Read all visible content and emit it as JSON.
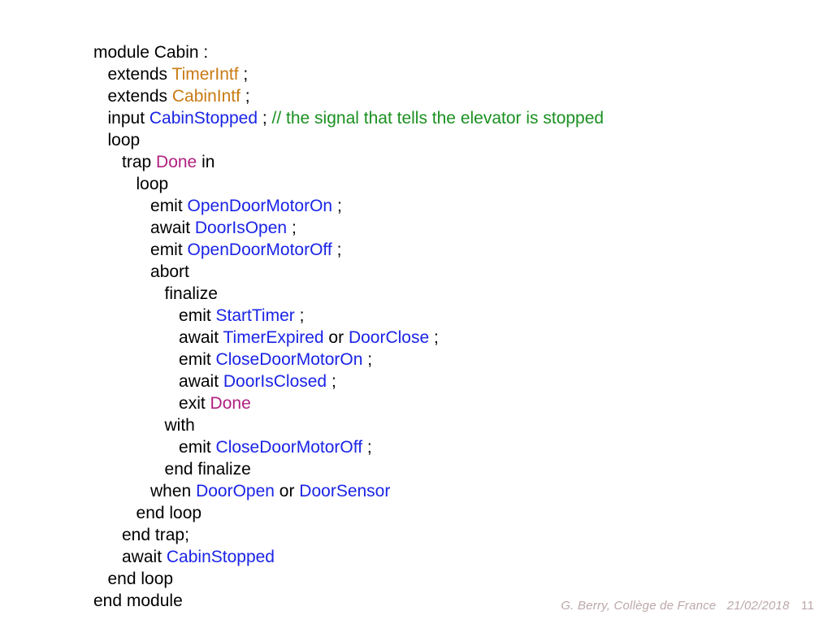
{
  "footer": {
    "author": "G. Berry, Collège de France",
    "date": "21/02/2018",
    "page": "11"
  },
  "code": {
    "l01a": "module Cabin :",
    "l02a": "   extends ",
    "l02b": "TimerIntf",
    "l02c": " ;",
    "l03a": "   extends ",
    "l03b": "CabinIntf",
    "l03c": " ;",
    "l04a": "   input ",
    "l04b": "CabinStopped",
    "l04c": " ; ",
    "l04d": "// the signal that tells the elevator is stopped",
    "l05a": "   loop",
    "l06a": "      trap ",
    "l06b": "Done",
    "l06c": " in",
    "l07a": "         loop",
    "l08a": "            emit ",
    "l08b": "OpenDoorMotorOn",
    "l08c": " ;",
    "l09a": "            await ",
    "l09b": "DoorIsOpen",
    "l09c": " ;",
    "l10a": "            emit ",
    "l10b": "OpenDoorMotorOff",
    "l10c": " ;",
    "l11a": "            abort",
    "l12a": "               finalize",
    "l13a": "                  emit ",
    "l13b": "StartTimer",
    "l13c": " ;",
    "l14a": "                  await ",
    "l14b": "TimerExpired",
    "l14c": " or ",
    "l14d": "DoorClose",
    "l14e": " ;",
    "l15a": "                  emit ",
    "l15b": "CloseDoorMotorOn",
    "l15c": " ;",
    "l16a": "                  await ",
    "l16b": "DoorIsClosed",
    "l16c": " ;",
    "l17a": "                  exit ",
    "l17b": "Done",
    "l18a": "               with",
    "l19a": "                  emit ",
    "l19b": "CloseDoorMotorOff",
    "l19c": " ;",
    "l20a": "               end finalize",
    "l21a": "            when ",
    "l21b": "DoorOpen",
    "l21c": " or ",
    "l21d": "DoorSensor",
    "l22a": "         end loop",
    "l23a": "      end trap;",
    "l24a": "      await ",
    "l24b": "CabinStopped",
    "l25a": "   end loop",
    "l26a": "end module"
  }
}
